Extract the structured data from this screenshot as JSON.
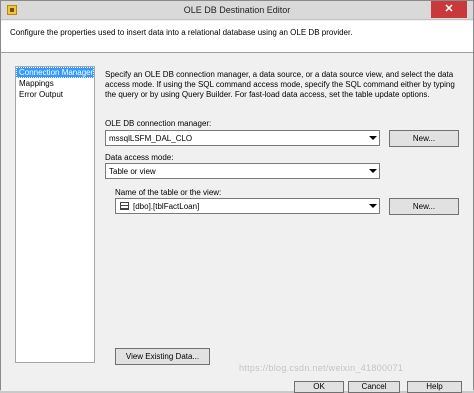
{
  "window": {
    "title": "OLE DB Destination Editor",
    "close_glyph": "✕"
  },
  "header": {
    "description": "Configure the properties used to insert data into a relational database using an OLE DB provider."
  },
  "nav": {
    "items": [
      {
        "label": "Connection Manager",
        "selected": true
      },
      {
        "label": "Mappings",
        "selected": false
      },
      {
        "label": "Error Output",
        "selected": false
      }
    ]
  },
  "main": {
    "description": "Specify an OLE DB connection manager, a data source, or a data source view, and select the data access mode. If using the SQL command access mode, specify the SQL command either by typing the query or by using Query Builder. For fast-load data access, set the table update options.",
    "connection_manager": {
      "label": "OLE DB connection manager:",
      "value": "mssqlLSFM_DAL_CLO",
      "new_button": "New..."
    },
    "data_access_mode": {
      "label": "Data access mode:",
      "value": "Table or view"
    },
    "table": {
      "label": "Name of the table or the view:",
      "value": "[dbo].[tblFactLoan]",
      "new_button": "New..."
    },
    "view_existing_button": "View Existing Data..."
  },
  "footer": {
    "ok_label": "OK",
    "cancel_label": "Cancel",
    "help_label": "Help"
  },
  "watermark": "https://blog.csdn.net/weixin_41800071"
}
